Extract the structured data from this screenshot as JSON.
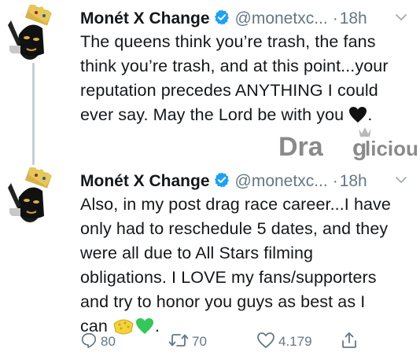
{
  "tweets": [
    {
      "display_name": "Monét X Change",
      "handle": "@monetxc...",
      "separator": "·",
      "time": "18h",
      "text_lines": [
        "The queens think you’re trash, the fans",
        "think you’re trash, and at this point...your",
        "reputation precedes ANYTHING I could",
        "ever say. May the Lord be with you"
      ],
      "text_end": ".",
      "emoji": [
        "black-heart"
      ]
    },
    {
      "display_name": "Monét X Change",
      "handle": "@monetxc...",
      "separator": "·",
      "time": "18h",
      "text_lines": [
        "Also, in my post drag race career...I have",
        "only had to reschedule 5 dates, and they",
        "were all due to All Stars filming",
        "obligations. I LOVE my fans/supporters",
        "and try to honor you guys as best as I",
        "can"
      ],
      "text_end": ".",
      "emoji": [
        "sponge",
        "green-heart"
      ]
    }
  ],
  "actions": {
    "reply_count": "80",
    "retweet_count": "70",
    "like_count": "4.179"
  },
  "watermark": {
    "text_dra": "Dra",
    "text_g": "g",
    "text_licious": "licious"
  },
  "colors": {
    "text": "#14171a",
    "muted": "#657786",
    "verified": "#1da1f2",
    "thread_line": "#c4cfd6",
    "watermark": "#8a8a8a"
  },
  "icons": [
    "verified-badge-icon",
    "chevron-down-icon",
    "reply-icon",
    "retweet-icon",
    "like-icon",
    "share-icon"
  ]
}
